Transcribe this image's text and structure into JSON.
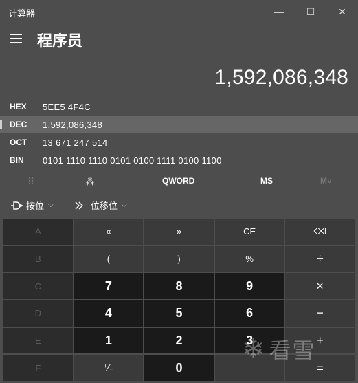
{
  "window": {
    "title": "计算器",
    "minimize": "—",
    "maximize": "☐",
    "close": "✕"
  },
  "header": {
    "mode_title": "程序员"
  },
  "display": {
    "value": "1,592,086,348"
  },
  "radix": [
    {
      "label": "HEX",
      "value": "5EE5 4F4C"
    },
    {
      "label": "DEC",
      "value": "1,592,086,348"
    },
    {
      "label": "OCT",
      "value": "13 671 247 514"
    },
    {
      "label": "BIN",
      "value": "0101 1110 1110 0101 0100 1111 0100 1100"
    }
  ],
  "mode_bar": {
    "keypad_icon": "⠿",
    "bit_icon": "⁂",
    "word_size": "QWORD",
    "ms": "MS",
    "mv": "M˅"
  },
  "toolbar": {
    "bitwise_label": "按位",
    "bitshift_label": "位移位",
    "chevron": "⌵"
  },
  "keypad": [
    [
      "A",
      "«",
      "»",
      "CE",
      "⌫"
    ],
    [
      "B",
      "(",
      ")",
      "%",
      "÷"
    ],
    [
      "C",
      "7",
      "8",
      "9",
      "×"
    ],
    [
      "D",
      "4",
      "5",
      "6",
      "−"
    ],
    [
      "E",
      "1",
      "2",
      "3",
      "+"
    ],
    [
      "F",
      "⁺∕₋",
      "0",
      "",
      "="
    ]
  ],
  "watermark": {
    "text": "看雪"
  }
}
